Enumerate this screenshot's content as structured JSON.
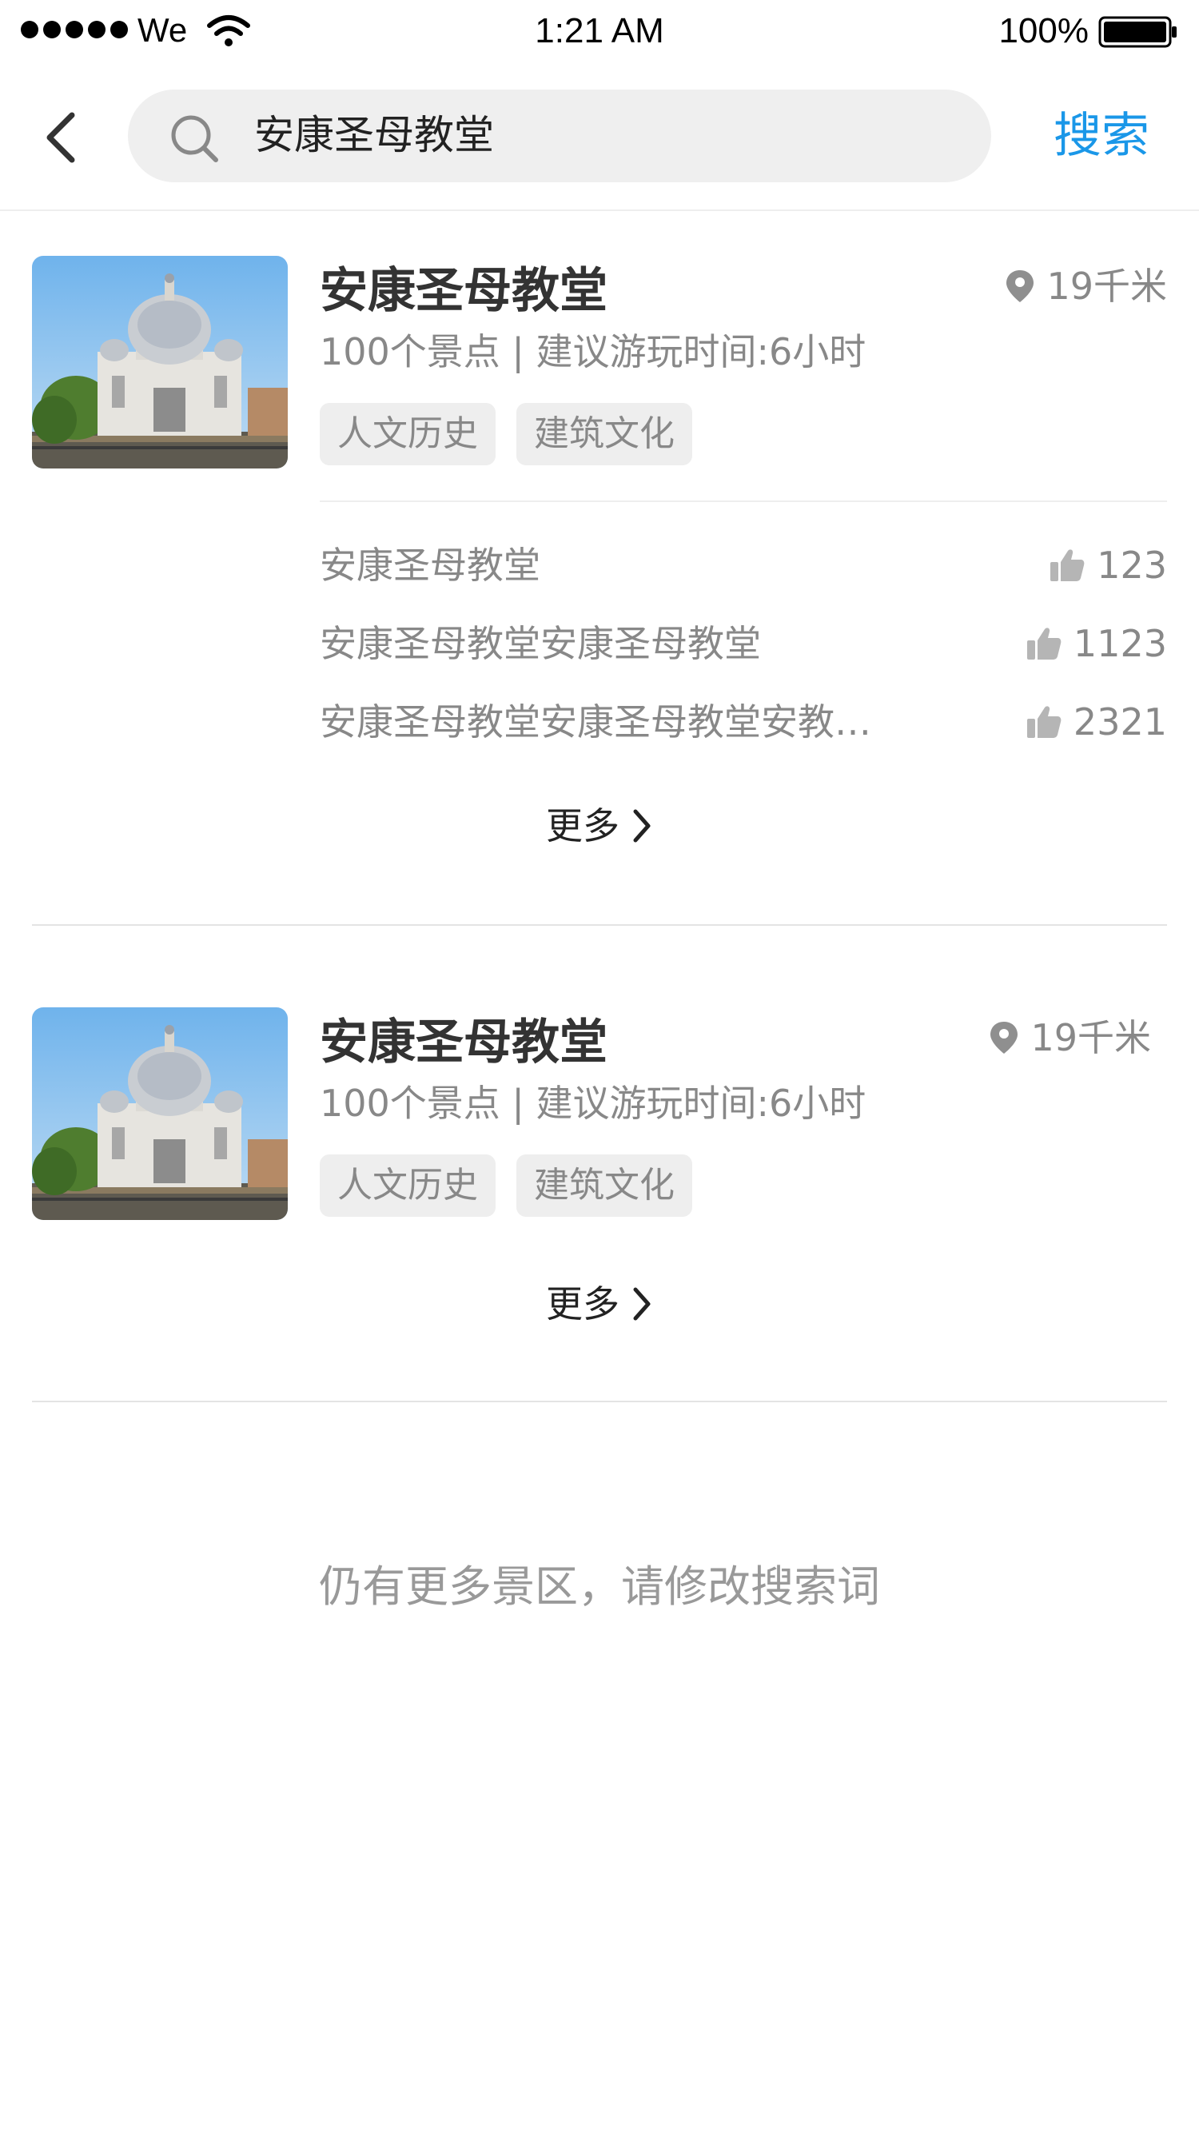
{
  "status_bar": {
    "carrier": "We",
    "time": "1:21 AM",
    "battery": "100%"
  },
  "nav": {
    "query": "安康圣母教堂",
    "search_label": "搜索"
  },
  "results": [
    {
      "title": "安康圣母教堂",
      "distance": "19千米",
      "subtitle": "100个景点 | 建议游玩时间:6小时",
      "tags": [
        "人文历史",
        "建筑文化"
      ],
      "reviews": [
        {
          "text": "安康圣母教堂",
          "likes": "123"
        },
        {
          "text": "安康圣母教堂安康圣母教堂",
          "likes": "1123"
        },
        {
          "text": "安康圣母教堂安康圣母教堂安教…",
          "likes": "2321"
        }
      ],
      "more_label": "更多"
    },
    {
      "title": "安康圣母教堂",
      "distance": "19千米",
      "subtitle": "100个景点 | 建议游玩时间:6小时",
      "tags": [
        "人文历史",
        "建筑文化"
      ],
      "more_label": "更多"
    }
  ],
  "footer_hint": "仍有更多景区，请修改搜索词",
  "colors": {
    "accent": "#1a97e8",
    "text_primary": "#333333",
    "text_secondary": "#888888",
    "tag_bg": "#eeeeee"
  },
  "icons": [
    "back-arrow-icon",
    "search-icon",
    "location-pin-icon",
    "thumbs-up-icon",
    "chevron-right-icon",
    "wifi-icon",
    "battery-icon"
  ]
}
